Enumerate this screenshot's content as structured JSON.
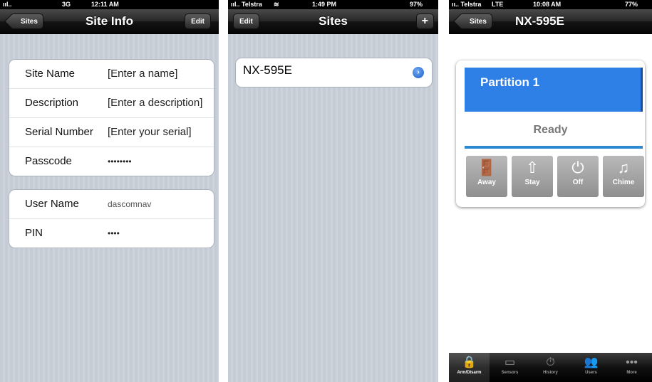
{
  "screen1": {
    "status": {
      "carrier": "ııl..",
      "network": "3G",
      "time": "12:11 AM"
    },
    "nav": {
      "back": "Sites",
      "title": "Site Info",
      "edit": "Edit"
    },
    "group1": [
      {
        "label": "Site Name",
        "value": "[Enter a name]"
      },
      {
        "label": "Description",
        "value": "[Enter a description]"
      },
      {
        "label": "Serial Number",
        "value": "[Enter your serial]"
      },
      {
        "label": "Passcode",
        "value": "••••••••"
      }
    ],
    "group2": [
      {
        "label": "User Name",
        "value": "dascomnav"
      },
      {
        "label": "PIN",
        "value": "••••"
      }
    ]
  },
  "screen2": {
    "status": {
      "carrier": "ııl.. Telstra",
      "wifi": "≋",
      "time": "1:49 PM",
      "battery": "97%"
    },
    "nav": {
      "edit": "Edit",
      "title": "Sites",
      "add": "+"
    },
    "site": {
      "name": "NX-595E",
      "arrow": "›"
    }
  },
  "screen3": {
    "status": {
      "carrier": "ıı.. Telstra",
      "network": "LTE",
      "time": "10:08 AM",
      "battery": "77%"
    },
    "nav": {
      "back": "Sites",
      "title": "NX-595E"
    },
    "partition": "Partition 1",
    "state": "Ready",
    "buttons": [
      {
        "label": "Away",
        "icon": "door-walk-icon"
      },
      {
        "label": "Stay",
        "icon": "home-arrow-icon"
      },
      {
        "label": "Off",
        "icon": "power-icon"
      },
      {
        "label": "Chime",
        "icon": "music-note-icon"
      }
    ],
    "tabs": [
      {
        "label": "Arm/Disarm",
        "icon": "lock-icon"
      },
      {
        "label": "Sensors",
        "icon": "sensor-icon"
      },
      {
        "label": "History",
        "icon": "stopwatch-icon"
      },
      {
        "label": "Users",
        "icon": "users-icon"
      },
      {
        "label": "More",
        "icon": "more-icon"
      }
    ],
    "colors": {
      "partition": "#2f80e6",
      "progress": "#2e8ad0",
      "active_tab": "#4a9eea"
    }
  }
}
